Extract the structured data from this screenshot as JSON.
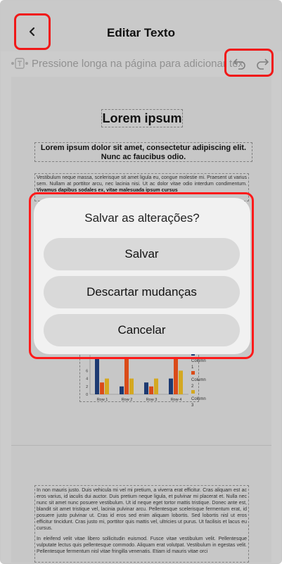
{
  "header": {
    "title": "Editar Texto",
    "back_icon": "chevron-left-icon"
  },
  "hint": {
    "text": "Pressione longa na página para adicionar texto",
    "icon": "text-insert-icon"
  },
  "toolbar": {
    "undo_icon": "undo-icon",
    "redo_icon": "redo-icon"
  },
  "document": {
    "title": "Lorem ipsum",
    "subtitle": "Lorem ipsum dolor sit amet, consectetur adipiscing elit. Nunc ac faucibus odio.",
    "paragraph_top": "Vestibulum neque massa, scelerisque sit amet ligula eu, congue molestie mi. Praesent ut varius sem. Nullam at porttitor arcu, nec lacinia nisi. Ut ac dolor vitae odio interdum condimentum.",
    "paragraph_top_bold": "Vivamus dapibus sodales ex, vitae malesuada ipsum cursus",
    "paragraph_bottom_1": "In non mauris justo. Duis vehicula mi vel mi pretium, a viverra erat efficitur. Cras aliquam est ac eros varius, id iaculis dui auctor. Duis pretium neque ligula, et pulvinar mi placerat et. Nulla nec nunc sit amet nunc posuere vestibulum. Ut id neque eget tortor mattis tristique. Donec ante est, blandit sit amet tristique vel, lacinia pulvinar arcu. Pellentesque scelerisque fermentum erat, id posuere justo pulvinar ut. Cras id eros sed enim aliquam lobortis. Sed lobortis nisl ut eros efficitur tincidunt. Cras justo mi, porttitor quis mattis vel, ultricies ut purus. Ut facilisis et lacus eu cursus.",
    "paragraph_bottom_2": "In eleifend velit vitae libero sollicitudin euismod. Fusce vitae vestibulum velit. Pellentesque vulputate lectus quis pellentesque commodo. Aliquam erat volutpat. Vestibulum in egestas velit. Pellentesque fermentum nisl vitae fringilla venenatis. Etiam id mauris vitae orci"
  },
  "chart_data": {
    "type": "bar",
    "categories": [
      "Row 1",
      "Row 2",
      "Row 3",
      "Row 4"
    ],
    "series": [
      {
        "name": "Column 1",
        "values": [
          9,
          2,
          3,
          4
        ]
      },
      {
        "name": "Column 2",
        "values": [
          3,
          9,
          2,
          9
        ]
      },
      {
        "name": "Column 3",
        "values": [
          4,
          4,
          4,
          6
        ]
      }
    ],
    "y_ticks": [
      "6",
      "4",
      "2",
      "0"
    ],
    "ylim": [
      0,
      10
    ],
    "colors": [
      "#1f3e7a",
      "#e8501b",
      "#e2b324"
    ],
    "legend_position": "right"
  },
  "dialog": {
    "title": "Salvar as alterações?",
    "save_label": "Salvar",
    "discard_label": "Descartar mudanças",
    "cancel_label": "Cancelar"
  },
  "colors": {
    "highlight": "#ff1a1a",
    "dialog_bg": "#f1f1f1",
    "button_bg": "#d9d9d9"
  }
}
